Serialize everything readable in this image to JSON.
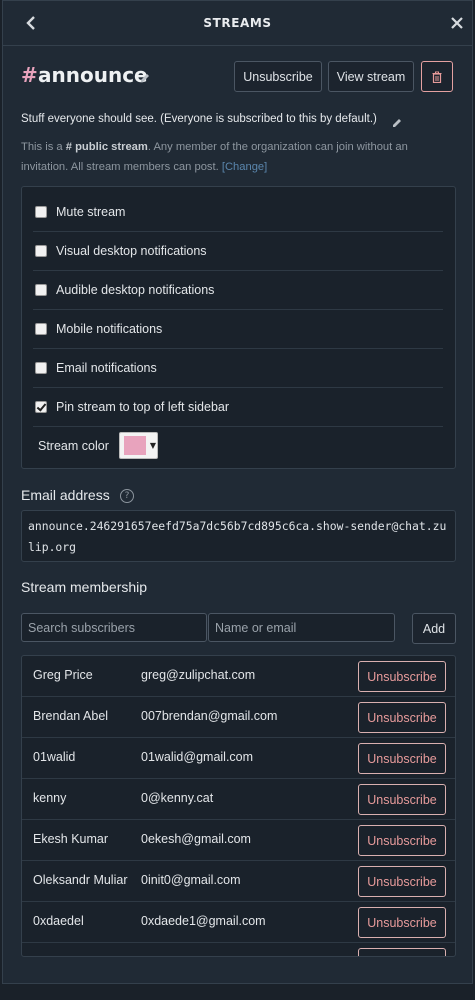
{
  "header": {
    "title": "STREAMS"
  },
  "stream": {
    "hash": "#",
    "name": "announce",
    "unsubscribe_label": "Unsubscribe",
    "view_stream_label": "View stream",
    "description": "Stuff everyone should see. (Everyone is subscribed to this by default.)",
    "info_prefix": "This is a",
    "info_bold": "# public stream",
    "info_suffix": ". Any member of the organization can join without an invitation. All stream members can post.",
    "info_change": "[Change]"
  },
  "settings": {
    "items": [
      {
        "label": "Mute stream",
        "checked": false
      },
      {
        "label": "Visual desktop notifications",
        "checked": false
      },
      {
        "label": "Audible desktop notifications",
        "checked": false
      },
      {
        "label": "Mobile notifications",
        "checked": false
      },
      {
        "label": "Email notifications",
        "checked": false
      },
      {
        "label": "Pin stream to top of left sidebar",
        "checked": true
      }
    ],
    "color_label": "Stream color",
    "color_value": "#e8a3bd"
  },
  "email": {
    "title": "Email address",
    "address": "announce.246291657eefd75a7dc56b7cd895c6ca.show-sender@chat.zulip.org"
  },
  "membership": {
    "title": "Stream membership",
    "search_placeholder": "Search subscribers",
    "name_email_placeholder": "Name or email",
    "add_label": "Add",
    "unsubscribe_label": "Unsubscribe",
    "members": [
      {
        "name": "Greg Price",
        "email": "greg@zulipchat.com"
      },
      {
        "name": "Brendan Abel",
        "email": "007brendan@gmail.com"
      },
      {
        "name": "01walid",
        "email": "01walid@gmail.com"
      },
      {
        "name": "kenny",
        "email": "0@kenny.cat"
      },
      {
        "name": "Ekesh Kumar",
        "email": "0ekesh@gmail.com"
      },
      {
        "name": "Oleksandr Muliar",
        "email": "0init0@gmail.com"
      },
      {
        "name": "0xdaedel",
        "email": "0xdaede1@gmail.com"
      },
      {
        "name": "",
        "email": ""
      }
    ]
  }
}
